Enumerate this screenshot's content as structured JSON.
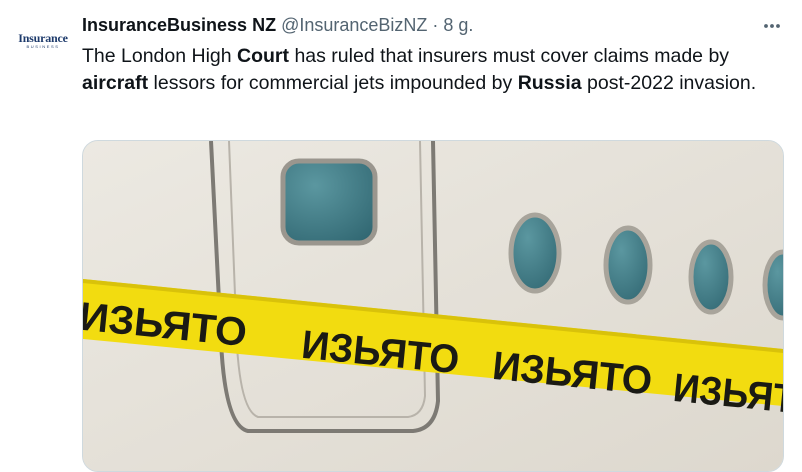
{
  "author": {
    "avatar_text": "Insurance",
    "avatar_subtext": "BUSINESS",
    "display_name": "InsuranceBusiness NZ",
    "handle": "@InsuranceBizNZ",
    "separator": "·",
    "timestamp": "8 g."
  },
  "tweet": {
    "segments": [
      {
        "text": "The London High ",
        "bold": false
      },
      {
        "text": "Court",
        "bold": true
      },
      {
        "text": " has ruled that insurers must cover claims made by ",
        "bold": false
      },
      {
        "text": "aircraft",
        "bold": true
      },
      {
        "text": " lessors for commercial jets impounded by ",
        "bold": false
      },
      {
        "text": "Russia",
        "bold": true
      },
      {
        "text": " post-2022 invasion.",
        "bold": false
      }
    ]
  },
  "media": {
    "tape_word": "ИЗЬЯТО",
    "colors": {
      "fuselage": "#e8e4dc",
      "tape": "#f2dc10",
      "window_glass": "#3f7f8a"
    }
  },
  "icons": {
    "more": "more-horizontal-icon"
  }
}
